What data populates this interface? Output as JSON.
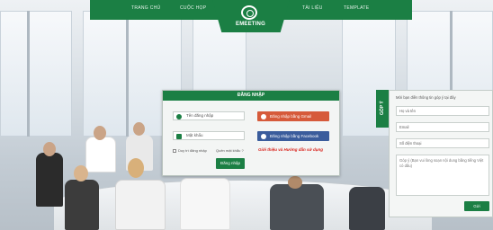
{
  "nav": {
    "items": [
      "TRANG CHỦ",
      "CUỘC HỌP",
      "TÀI LIỆU",
      "TEMPLATE"
    ],
    "logo_text": "EMEETING"
  },
  "login": {
    "title": "ĐĂNG NHẬP",
    "username_placeholder": "Tên đăng nhập",
    "password_placeholder": "Mật khẩu",
    "gmail_label": "Đăng nhập bằng Gmail",
    "facebook_label": "Đăng nhập bằng Facebook",
    "remember_label": "Duy trì đăng nhập",
    "forgot_label": "Quên mật khẩu ?",
    "intro_link": "Giới thiệu và Hướng dẫn sử dụng",
    "submit_label": "Đăng nhập"
  },
  "feedback": {
    "tab_label": "GÓP Ý",
    "intro": "Mời bạn điền thông tin góp ý tại đây",
    "name_placeholder": "Họ và tên",
    "email_placeholder": "Email",
    "phone_placeholder": "Số điện thoại",
    "message_placeholder": "Góp ý (Bạn vui lòng soạn nội dung bằng tiếng Việt có dấu)",
    "send_label": "Gửi"
  },
  "colors": {
    "brand_green": "#1b7f44",
    "gmail_red": "#d65a3a",
    "facebook_blue": "#3a5c9c",
    "link_red": "#d9241d"
  }
}
